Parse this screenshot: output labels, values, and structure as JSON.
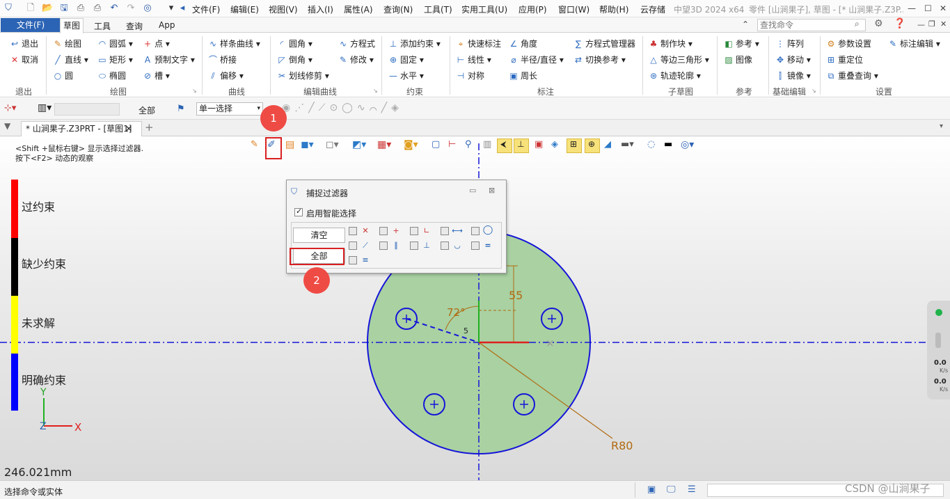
{
  "titlebar": {
    "menus": [
      "文件(F)",
      "编辑(E)",
      "视图(V)",
      "插入(I)",
      "属性(A)",
      "查询(N)",
      "工具(T)",
      "实用工具(U)",
      "应用(P)",
      "窗口(W)",
      "帮助(H)",
      "云存储"
    ],
    "app_name": "中望3D 2024 x64",
    "doc_title": "零件 [山涧果子], 草图 - [* 山涧果子.Z3P..."
  },
  "ribbon_tabs": {
    "file": "文件(F)",
    "sketch": "草图",
    "tools": "工具",
    "query": "查询",
    "app": "App"
  },
  "search": {
    "placeholder": "查找命令"
  },
  "ribbon": {
    "exit": {
      "items": [
        "退出",
        "取消"
      ],
      "label": "退出"
    },
    "draw": {
      "items": [
        "绘图",
        "直线",
        "圆",
        "圆弧",
        "矩形",
        "椭圆",
        "点",
        "预制文字",
        "槽"
      ],
      "label": "绘图"
    },
    "curve": {
      "items": [
        "样条曲线",
        "桥接",
        "偏移"
      ],
      "label": "曲线"
    },
    "edit_curve": {
      "items": [
        "圆角",
        "倒角",
        "划线修剪",
        "方程式",
        "修改"
      ],
      "label": "编辑曲线"
    },
    "constraint": {
      "items": [
        "添加约束",
        "固定",
        "水平"
      ],
      "label": "约束"
    },
    "dimension": {
      "items": [
        "快速标注",
        "线性",
        "对称",
        "角度",
        "半径/直径",
        "周长",
        "方程式管理器",
        "切换参考"
      ],
      "label": "标注"
    },
    "subsketch": {
      "items": [
        "制作块",
        "等边三角形",
        "轨迹轮廓"
      ],
      "label": "子草图"
    },
    "reference": {
      "items": [
        "参考",
        "图像"
      ],
      "label": "参考"
    },
    "basic_edit": {
      "items": [
        "阵列",
        "移动",
        "镜像"
      ],
      "label": "基础编辑"
    },
    "settings": {
      "items": [
        "参数设置",
        "重定位",
        "重叠查询",
        "标注编辑"
      ],
      "label": "设置"
    }
  },
  "quickbar": {
    "filter_all": "全部",
    "select_mode": "单一选择"
  },
  "doc_tab": {
    "title": "* 山涧果子.Z3PRT - [草图1]",
    "close": "✕",
    "add": "+"
  },
  "canvas": {
    "hint_line1": "<Shift +鼠标右键> 显示选择过滤器.",
    "hint_line2": "按下<F2> 动态的观察",
    "legend": [
      {
        "label": "过约束",
        "color": "#ff0000"
      },
      {
        "label": "缺少约束",
        "color": "#000000"
      },
      {
        "label": "未求解",
        "color": "#ffff00"
      },
      {
        "label": "明确约束",
        "color": "#0000ff"
      }
    ],
    "dim_angle": "72°",
    "dim_55": "55",
    "dim_5": "5",
    "dim_r80": "R80",
    "axis_x": "X",
    "axis_y": "Y",
    "axis_z": "Z",
    "measure": "246.021mm",
    "speed1": "0.0",
    "speed1_unit": "K/s",
    "speed2": "0.0",
    "speed2_unit": "K/s"
  },
  "dialog": {
    "title": "捕捉过滤器",
    "enable_smart": "启用智能选择",
    "clear": "清空",
    "all": "全部"
  },
  "callouts": {
    "one": "1",
    "two": "2"
  },
  "status": {
    "text": "选择命令或实体",
    "watermark": "CSDN @山涧果子"
  }
}
